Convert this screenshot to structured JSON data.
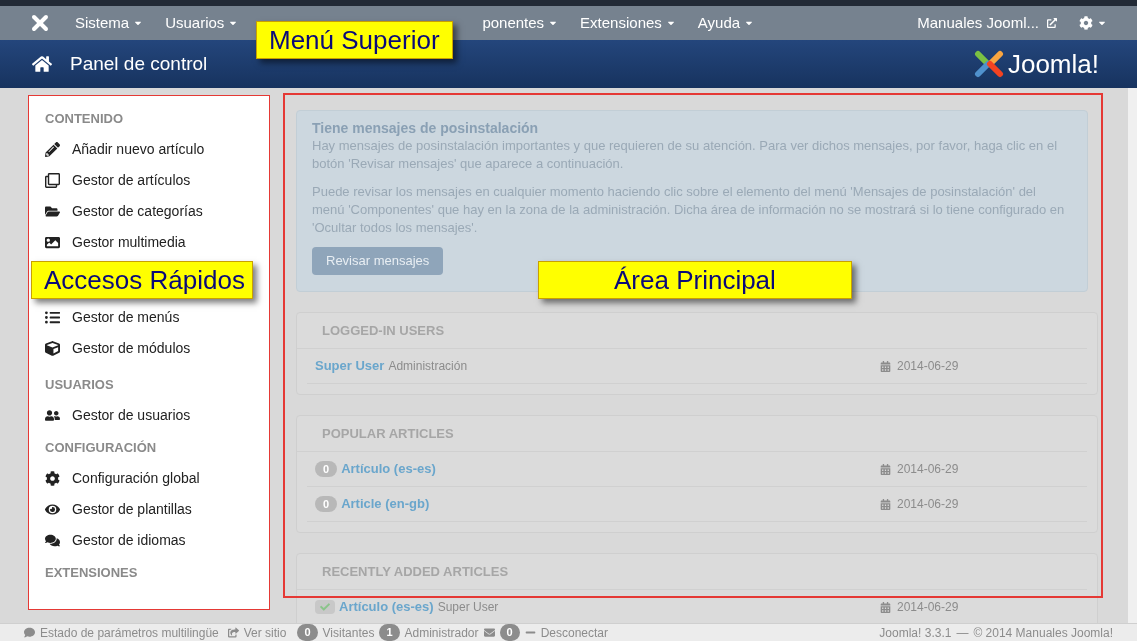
{
  "top_menu": {
    "items": [
      {
        "label": "Sistema"
      },
      {
        "label": "Usuarios"
      },
      {
        "label": "ponentes"
      },
      {
        "label": "Extensiones"
      },
      {
        "label": "Ayuda"
      }
    ],
    "site_link": "Manuales Jooml..."
  },
  "header": {
    "title": "Panel de control",
    "logo_text": "Joomla!"
  },
  "sidebar": {
    "sections": [
      {
        "heading": "CONTENIDO",
        "items": [
          {
            "label": "Añadir nuevo artículo"
          },
          {
            "label": "Gestor de artículos"
          },
          {
            "label": "Gestor de categorías"
          },
          {
            "label": "Gestor multimedia"
          }
        ]
      },
      {
        "items": [
          {
            "label": "Gestor de menús"
          },
          {
            "label": "Gestor de módulos"
          }
        ]
      },
      {
        "heading": "USUARIOS",
        "items": [
          {
            "label": "Gestor de usuarios"
          }
        ]
      },
      {
        "heading": "CONFIGURACIÓN",
        "items": [
          {
            "label": "Configuración global"
          },
          {
            "label": "Gestor de plantillas"
          },
          {
            "label": "Gestor de idiomas"
          }
        ]
      },
      {
        "heading": "EXTENSIONES"
      }
    ]
  },
  "callouts": [
    {
      "text": "Menú Superior"
    },
    {
      "text": "Accesos Rápidos"
    },
    {
      "text": "Área Principal"
    }
  ],
  "message": {
    "title": "Tiene mensajes de posinstalación",
    "paragraphs": [
      "Hay mensajes de posinstalación importantes y que requieren de su atención. Para ver dichos mensajes, por favor, haga clic en el botón 'Revisar mensajes' que aparece a continuación.",
      "Puede revisar los mensajes en cualquier momento haciendo clic sobre el elemento del menú 'Mensajes de posinstalación' del menú 'Componentes' que hay en la zona de la administración. Dicha área de información no se mostrará si lo tiene configurado en 'Ocultar todos los mensajes'."
    ],
    "button": "Revisar mensajes"
  },
  "panels": [
    {
      "title": "LOGGED-IN USERS",
      "rows": [
        {
          "kind": "user",
          "name": "Super User",
          "detail": "Administración",
          "date": "2014-06-29"
        }
      ]
    },
    {
      "title": "POPULAR ARTICLES",
      "rows": [
        {
          "kind": "popular",
          "count": "0",
          "name": "Artículo (es-es)",
          "date": "2014-06-29"
        },
        {
          "kind": "popular",
          "count": "0",
          "name": "Article (en-gb)",
          "date": "2014-06-29"
        }
      ]
    },
    {
      "title": "RECENTLY ADDED ARTICLES",
      "rows": [
        {
          "kind": "recent",
          "name": "Artículo (es-es)",
          "detail": "Super User",
          "date": "2014-06-29"
        }
      ]
    }
  ],
  "status_bar": {
    "multilang": "Estado de parámetros multilingüe",
    "view_site": "Ver sitio",
    "visitors": {
      "count": "0",
      "label": "Visitantes"
    },
    "admins": {
      "count": "1",
      "label": "Administrador"
    },
    "messages": {
      "count": "0"
    },
    "logout": "Desconectar",
    "version": "Joomla! 3.3.1",
    "separator": "—",
    "copyright": "© 2014 Manuales Joomla!"
  }
}
